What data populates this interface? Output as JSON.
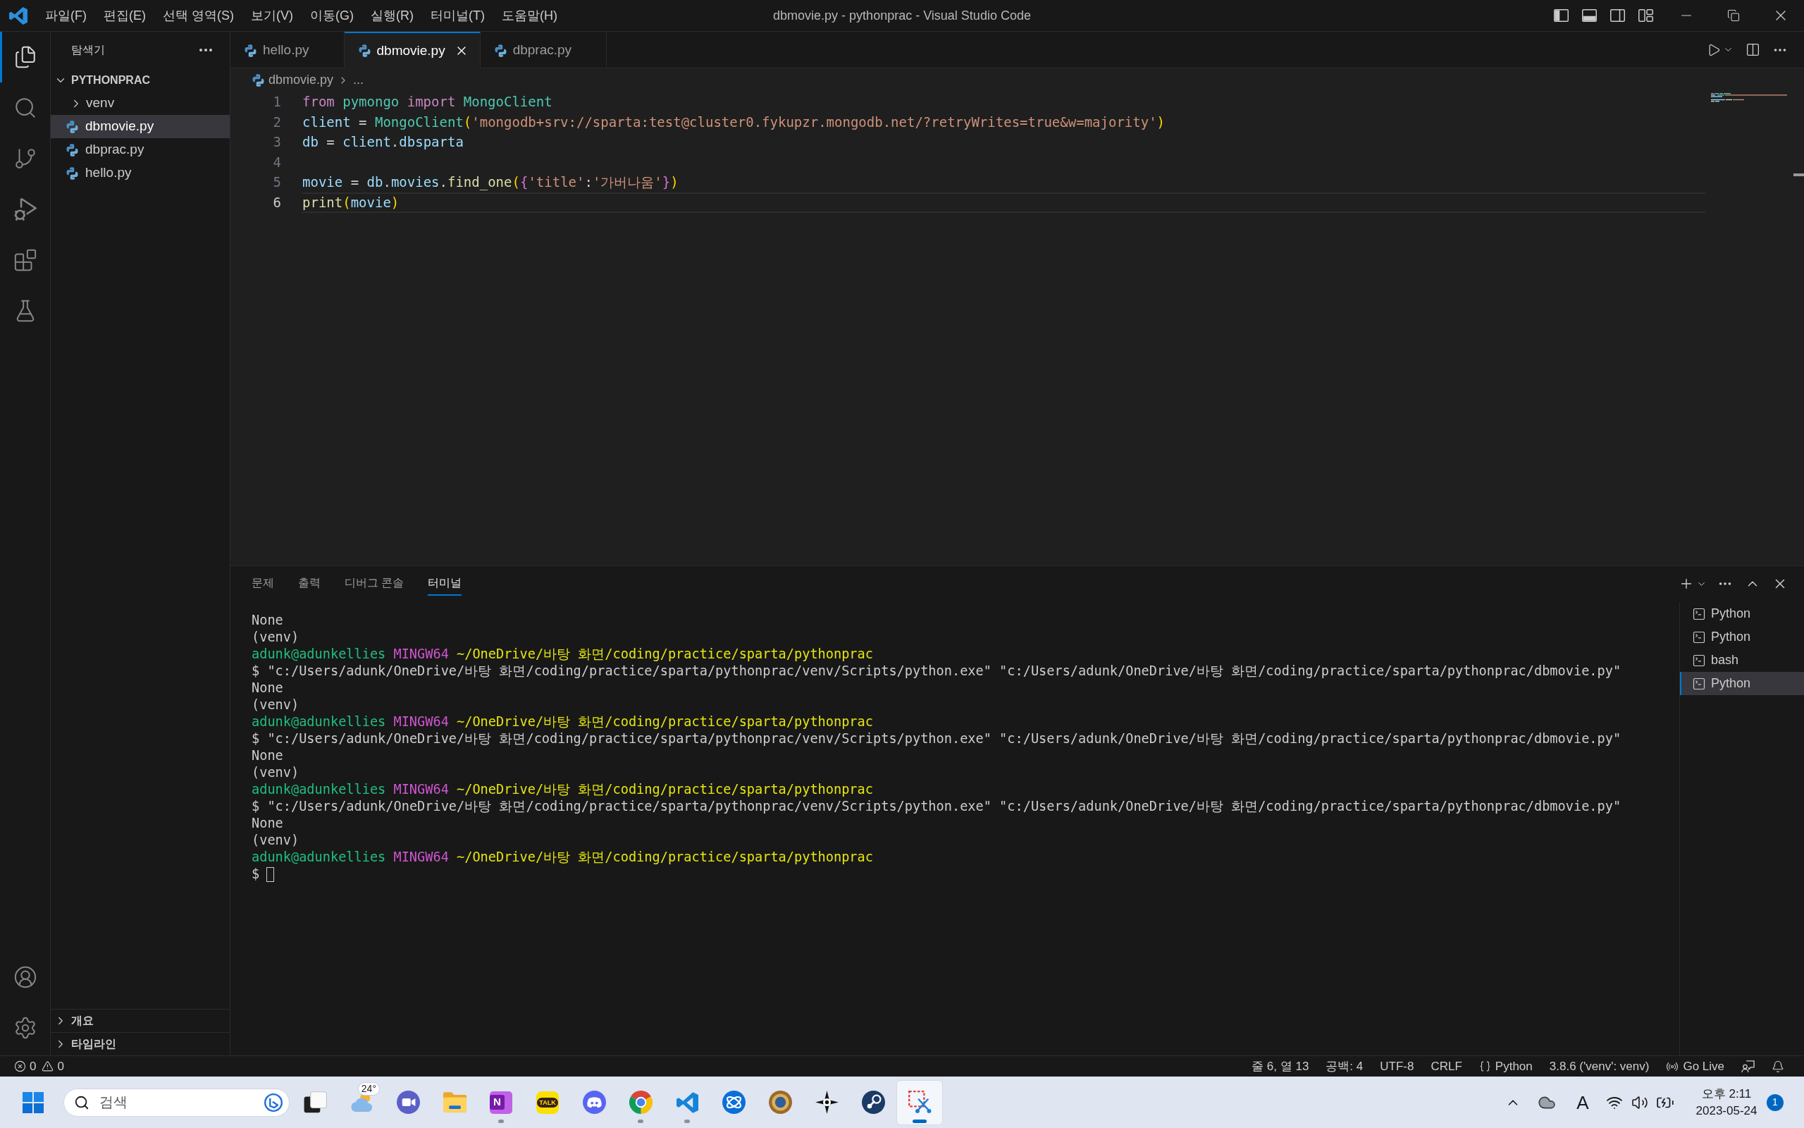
{
  "title_bar": {
    "menu": [
      "파일(F)",
      "편집(E)",
      "선택 영역(S)",
      "보기(V)",
      "이동(G)",
      "실행(R)",
      "터미널(T)",
      "도움말(H)"
    ],
    "title": "dbmovie.py - pythonprac - Visual Studio Code"
  },
  "activity_bar": {
    "items": [
      {
        "kind": "explorer",
        "selected": true
      },
      {
        "kind": "search",
        "selected": false
      },
      {
        "kind": "source-control",
        "selected": false
      },
      {
        "kind": "run-debug",
        "selected": false
      },
      {
        "kind": "extensions",
        "selected": false
      },
      {
        "kind": "testing",
        "selected": false
      }
    ],
    "bottom": [
      {
        "kind": "account"
      },
      {
        "kind": "settings"
      }
    ]
  },
  "sidebar": {
    "title": "탐색기",
    "folder": {
      "name": "PYTHONPRAC",
      "expanded": true,
      "children": [
        {
          "name": "venv",
          "kind": "folder",
          "expanded": false,
          "selected": false
        },
        {
          "name": "dbmovie.py",
          "kind": "file",
          "selected": true
        },
        {
          "name": "dbprac.py",
          "kind": "file",
          "selected": false
        },
        {
          "name": "hello.py",
          "kind": "file",
          "selected": false
        }
      ]
    },
    "sections": [
      {
        "label": "개요",
        "expanded": false
      },
      {
        "label": "타임라인",
        "expanded": false
      }
    ]
  },
  "tabs": [
    {
      "label": "hello.py",
      "selected": false
    },
    {
      "label": "dbmovie.py",
      "selected": true
    },
    {
      "label": "dbprac.py",
      "selected": false
    }
  ],
  "breadcrumb": [
    "dbmovie.py",
    "..."
  ],
  "editor": {
    "lines": [
      {
        "number": "1",
        "current": false,
        "tokens": [
          {
            "kind": "keyword",
            "text": "from "
          },
          {
            "kind": "type",
            "text": "pymongo "
          },
          {
            "kind": "keyword",
            "text": "import "
          },
          {
            "kind": "type",
            "text": "MongoClient"
          }
        ]
      },
      {
        "number": "2",
        "current": false,
        "tokens": [
          {
            "kind": "variable",
            "text": "client"
          },
          {
            "kind": "plain",
            "text": " = "
          },
          {
            "kind": "type",
            "text": "MongoClient"
          },
          {
            "kind": "bracket1",
            "text": "("
          },
          {
            "kind": "string",
            "text": "'mongodb+srv://sparta:test@cluster0.fykupzr.mongodb.net/?retryWrites=true&w=majority'"
          },
          {
            "kind": "bracket1",
            "text": ")"
          }
        ]
      },
      {
        "number": "3",
        "current": false,
        "tokens": [
          {
            "kind": "variable",
            "text": "db"
          },
          {
            "kind": "plain",
            "text": " = "
          },
          {
            "kind": "variable",
            "text": "client"
          },
          {
            "kind": "plain",
            "text": "."
          },
          {
            "kind": "variable",
            "text": "dbsparta"
          }
        ]
      },
      {
        "number": "4",
        "current": false
      },
      {
        "number": "5",
        "current": false,
        "tokens": [
          {
            "kind": "variable",
            "text": "movie"
          },
          {
            "kind": "plain",
            "text": " = "
          },
          {
            "kind": "variable",
            "text": "db"
          },
          {
            "kind": "plain",
            "text": "."
          },
          {
            "kind": "variable",
            "text": "movies"
          },
          {
            "kind": "plain",
            "text": "."
          },
          {
            "kind": "function",
            "text": "find_one"
          },
          {
            "kind": "bracket1",
            "text": "("
          },
          {
            "kind": "bracket2",
            "text": "{"
          },
          {
            "kind": "string",
            "text": "'title'"
          },
          {
            "kind": "plain",
            "text": ":"
          },
          {
            "kind": "string",
            "text": "'가버나움'"
          },
          {
            "kind": "bracket2",
            "text": "}"
          },
          {
            "kind": "bracket1",
            "text": ")"
          }
        ]
      },
      {
        "number": "6",
        "current": true,
        "tokens": [
          {
            "kind": "function",
            "text": "print"
          },
          {
            "kind": "bracket1",
            "text": "("
          },
          {
            "kind": "variable",
            "text": "movie"
          },
          {
            "kind": "bracket1",
            "text": ")"
          }
        ]
      }
    ]
  },
  "panel": {
    "tabs": [
      {
        "label": "문제",
        "selected": false
      },
      {
        "label": "출력",
        "selected": false
      },
      {
        "label": "디버그 콘솔",
        "selected": false
      },
      {
        "label": "터미널",
        "selected": true
      }
    ],
    "terminal": {
      "lines": [
        {
          "cursor": false,
          "segments": [
            {
              "kind": "output",
              "text": "None"
            }
          ]
        },
        {
          "cursor": false,
          "segments": [
            {
              "kind": "output",
              "text": "(venv)"
            }
          ]
        },
        {
          "cursor": false,
          "segments": [
            {
              "kind": "user",
              "text": "adunk@adunkellies"
            },
            {
              "kind": "host",
              "text": "MINGW64"
            },
            {
              "kind": "path",
              "text": "~/OneDrive/바탕 화면/coding/practice/sparta/pythonprac"
            }
          ]
        },
        {
          "cursor": false,
          "segments": [
            {
              "kind": "output",
              "text": "$ \"c:/Users/adunk/OneDrive/바탕 화면/coding/practice/sparta/pythonprac/venv/Scripts/python.exe\" \"c:/Users/adunk/OneDrive/바탕 화면/coding/practice/sparta/pythonprac/dbmovie.py\""
            }
          ]
        },
        {
          "cursor": false,
          "segments": [
            {
              "kind": "output",
              "text": "None"
            }
          ]
        },
        {
          "cursor": false,
          "segments": [
            {
              "kind": "output",
              "text": "(venv)"
            }
          ]
        },
        {
          "cursor": false,
          "segments": [
            {
              "kind": "user",
              "text": "adunk@adunkellies"
            },
            {
              "kind": "host",
              "text": "MINGW64"
            },
            {
              "kind": "path",
              "text": "~/OneDrive/바탕 화면/coding/practice/sparta/pythonprac"
            }
          ]
        },
        {
          "cursor": false,
          "segments": [
            {
              "kind": "output",
              "text": "$ \"c:/Users/adunk/OneDrive/바탕 화면/coding/practice/sparta/pythonprac/venv/Scripts/python.exe\" \"c:/Users/adunk/OneDrive/바탕 화면/coding/practice/sparta/pythonprac/dbmovie.py\""
            }
          ]
        },
        {
          "cursor": false,
          "segments": [
            {
              "kind": "output",
              "text": "None"
            }
          ]
        },
        {
          "cursor": false,
          "segments": [
            {
              "kind": "output",
              "text": "(venv)"
            }
          ]
        },
        {
          "cursor": false,
          "segments": [
            {
              "kind": "user",
              "text": "adunk@adunkellies"
            },
            {
              "kind": "host",
              "text": "MINGW64"
            },
            {
              "kind": "path",
              "text": "~/OneDrive/바탕 화면/coding/practice/sparta/pythonprac"
            }
          ]
        },
        {
          "cursor": false,
          "segments": [
            {
              "kind": "output",
              "text": "$ \"c:/Users/adunk/OneDrive/바탕 화면/coding/practice/sparta/pythonprac/venv/Scripts/python.exe\" \"c:/Users/adunk/OneDrive/바탕 화면/coding/practice/sparta/pythonprac/dbmovie.py\""
            }
          ]
        },
        {
          "cursor": false,
          "segments": [
            {
              "kind": "output",
              "text": "None"
            }
          ]
        },
        {
          "cursor": false,
          "segments": [
            {
              "kind": "output",
              "text": "(venv)"
            }
          ]
        },
        {
          "cursor": false,
          "segments": [
            {
              "kind": "user",
              "text": "adunk@adunkellies"
            },
            {
              "kind": "host",
              "text": "MINGW64"
            },
            {
              "kind": "path",
              "text": "~/OneDrive/바탕 화면/coding/practice/sparta/pythonprac"
            }
          ]
        },
        {
          "cursor": true,
          "segments": [
            {
              "kind": "output",
              "text": "$"
            }
          ]
        }
      ]
    },
    "sessions": [
      {
        "label": "Python",
        "selected": false
      },
      {
        "label": "Python",
        "selected": false
      },
      {
        "label": "bash",
        "selected": false
      },
      {
        "label": "Python",
        "selected": true
      }
    ]
  },
  "status_bar": {
    "problems": {
      "errors": "0",
      "warnings": "0"
    },
    "items": [
      {
        "kind": "text",
        "text": "줄 6, 열 13"
      },
      {
        "kind": "text",
        "text": "공백: 4"
      },
      {
        "kind": "text",
        "text": "UTF-8"
      },
      {
        "kind": "text",
        "text": "CRLF"
      },
      {
        "kind": "language",
        "text": "Python"
      },
      {
        "kind": "text",
        "text": "3.8.6 ('venv': venv)"
      },
      {
        "kind": "live",
        "text": "Go Live"
      },
      {
        "kind": "feedback"
      },
      {
        "kind": "notifications"
      }
    ]
  },
  "taskbar": {
    "search": {
      "placeholder": "검색"
    },
    "apps": [
      {
        "kind": "task-view",
        "running": false,
        "active": false
      },
      {
        "kind": "weather",
        "badge": "24°",
        "running": false,
        "active": false
      },
      {
        "kind": "video-chat",
        "running": false,
        "active": false
      },
      {
        "kind": "folder",
        "running": false,
        "active": false
      },
      {
        "kind": "notes",
        "glyph": "N",
        "running": true,
        "active": false
      },
      {
        "kind": "messenger",
        "glyph": "TALK",
        "running": false,
        "active": false
      },
      {
        "kind": "voice-chat",
        "running": false,
        "active": false
      },
      {
        "kind": "browser",
        "running": true,
        "active": false
      },
      {
        "kind": "code-editor",
        "running": true,
        "active": false
      },
      {
        "kind": "launcher",
        "running": false,
        "active": false
      },
      {
        "kind": "card-game",
        "running": false,
        "active": false
      },
      {
        "kind": "star-app",
        "running": false,
        "active": false
      },
      {
        "kind": "game-store",
        "running": false,
        "active": false
      },
      {
        "kind": "snipping",
        "running": true,
        "active": true
      }
    ],
    "tray": {
      "ime": "A",
      "time": "오후 2:11",
      "date": "2023-05-24",
      "notifications": "1"
    }
  }
}
